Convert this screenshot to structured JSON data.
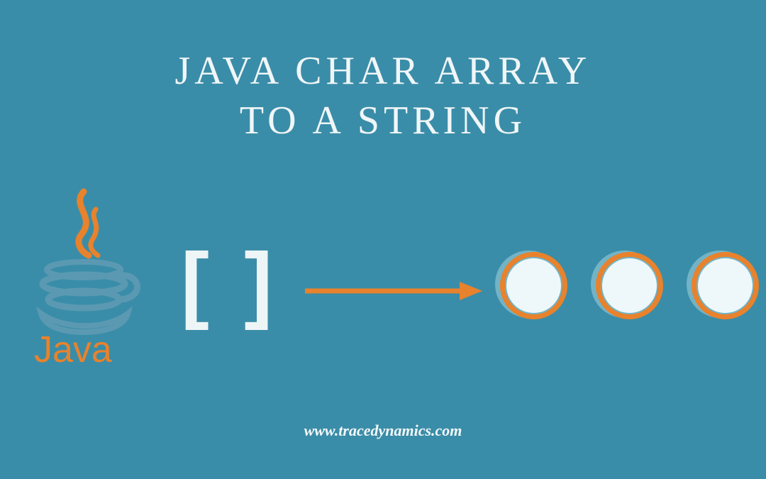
{
  "title_line1": "JAVA CHAR ARRAY",
  "title_line2": "TO A STRING",
  "logo_text": "Java",
  "brackets_text": "[ ]",
  "footer_url": "www.tracedynamics.com",
  "colors": {
    "background": "#3a8da8",
    "accent": "#e8822c",
    "light": "#eef5f7"
  }
}
